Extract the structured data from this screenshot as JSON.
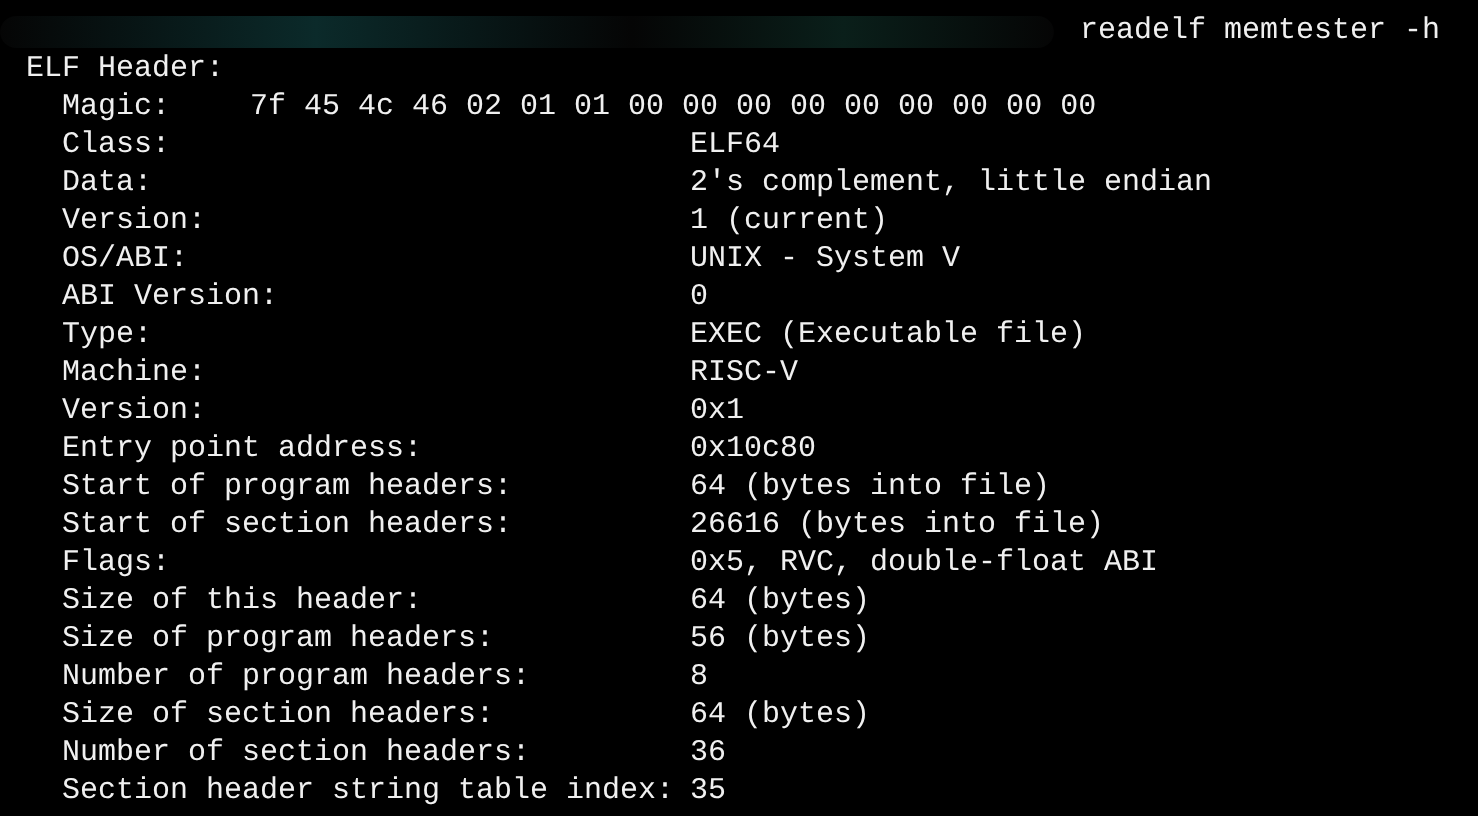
{
  "command": "readelf memtester -h",
  "header_title": "ELF Header:",
  "fields": [
    {
      "label": "Magic:",
      "value": "7f 45 4c 46 02 01 01 00 00 00 00 00 00 00 00 00",
      "kind": "magic"
    },
    {
      "label": "Class:",
      "value": "ELF64",
      "kind": "field"
    },
    {
      "label": "Data:",
      "value": "2's complement, little endian",
      "kind": "field"
    },
    {
      "label": "Version:",
      "value": "1 (current)",
      "kind": "field"
    },
    {
      "label": "OS/ABI:",
      "value": "UNIX - System V",
      "kind": "field"
    },
    {
      "label": "ABI Version:",
      "value": "0",
      "kind": "field"
    },
    {
      "label": "Type:",
      "value": "EXEC (Executable file)",
      "kind": "field"
    },
    {
      "label": "Machine:",
      "value": "RISC-V",
      "kind": "field"
    },
    {
      "label": "Version:",
      "value": "0x1",
      "kind": "field"
    },
    {
      "label": "Entry point address:",
      "value": "0x10c80",
      "kind": "field"
    },
    {
      "label": "Start of program headers:",
      "value": "64 (bytes into file)",
      "kind": "field"
    },
    {
      "label": "Start of section headers:",
      "value": "26616 (bytes into file)",
      "kind": "field"
    },
    {
      "label": "Flags:",
      "value": "0x5, RVC, double-float ABI",
      "kind": "field"
    },
    {
      "label": "Size of this header:",
      "value": "64 (bytes)",
      "kind": "field"
    },
    {
      "label": "Size of program headers:",
      "value": "56 (bytes)",
      "kind": "field"
    },
    {
      "label": "Number of program headers:",
      "value": "8",
      "kind": "field"
    },
    {
      "label": "Size of section headers:",
      "value": "64 (bytes)",
      "kind": "field"
    },
    {
      "label": "Number of section headers:",
      "value": "36",
      "kind": "field"
    },
    {
      "label": "Section header string table index:",
      "value": "35",
      "kind": "field"
    }
  ]
}
